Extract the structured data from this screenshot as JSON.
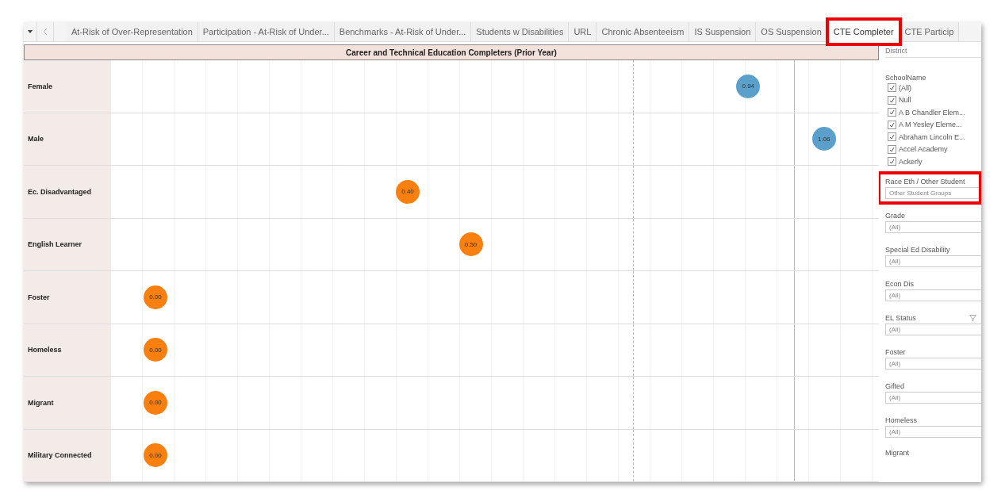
{
  "tabs": [
    {
      "label": "At-Risk of Over-Representation",
      "selected": false
    },
    {
      "label": "Participation - At-Risk of Under...",
      "selected": false
    },
    {
      "label": "Benchmarks - At-Risk of Under...",
      "selected": false
    },
    {
      "label": "Students w Disabilities",
      "selected": false
    },
    {
      "label": "URL",
      "selected": false
    },
    {
      "label": "Chronic Absenteeism",
      "selected": false
    },
    {
      "label": "IS Suspension",
      "selected": false
    },
    {
      "label": "OS Suspension",
      "selected": false
    },
    {
      "label": "CTE Completer",
      "selected": true
    },
    {
      "label": "CTE Particip",
      "selected": false
    }
  ],
  "chart": {
    "title": "Career and Technical Education Completers (Prior Year)",
    "rows": [
      {
        "label": "Female",
        "value": "0.94",
        "color": "#5b9fcb"
      },
      {
        "label": "Male",
        "value": "1.06",
        "color": "#5b9fcb"
      },
      {
        "label": "Ec. Disadvantaged",
        "value": "0.40",
        "color": "#f97f0f"
      },
      {
        "label": "English Learner",
        "value": "0.50",
        "color": "#f97f0f"
      },
      {
        "label": "Foster",
        "value": "0.00",
        "color": "#f97f0f"
      },
      {
        "label": "Homeless",
        "value": "0.00",
        "color": "#f97f0f"
      },
      {
        "label": "Migrant",
        "value": "0.00",
        "color": "#f97f0f"
      },
      {
        "label": "Military Connected",
        "value": "0.00",
        "color": "#f97f0f"
      }
    ]
  },
  "filters": {
    "district_label": "District",
    "school": {
      "label": "SchoolName",
      "options": [
        {
          "label": "(All)",
          "checked": true
        },
        {
          "label": "Null",
          "checked": true
        },
        {
          "label": "A B Chandler Elem...",
          "checked": true
        },
        {
          "label": "A M Yesley Eleme...",
          "checked": true
        },
        {
          "label": "Abraham Lincoln E...",
          "checked": true
        },
        {
          "label": "Accel Academy",
          "checked": true
        },
        {
          "label": "Ackerly",
          "checked": true
        }
      ]
    },
    "race": {
      "label": "Race Eth / Other Student",
      "value": "Other Student Groups"
    },
    "dropdowns": [
      {
        "label": "Grade",
        "value": "(All)",
        "filtered": false
      },
      {
        "label": "Special Ed Disability",
        "value": "(All)",
        "filtered": false
      },
      {
        "label": "Econ Dis",
        "value": "(All)",
        "filtered": false
      },
      {
        "label": "EL Status",
        "value": "(All)",
        "filtered": true
      },
      {
        "label": "Foster",
        "value": "(All)",
        "filtered": false
      },
      {
        "label": "Gifted",
        "value": "(All)",
        "filtered": false
      },
      {
        "label": "Homeless",
        "value": "(All)",
        "filtered": false
      }
    ],
    "last_label": "Migrant"
  }
}
